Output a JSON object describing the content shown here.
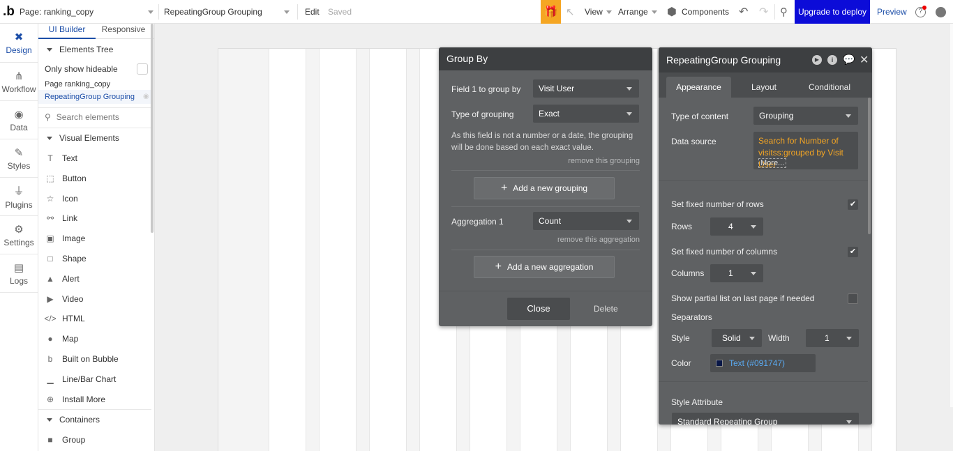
{
  "topbar": {
    "page_label": "Page: ranking_copy",
    "element_selector": "RepeatingGroup Grouping",
    "edit_label": "Edit",
    "saved_label": "Saved",
    "view_label": "View",
    "arrange_label": "Arrange",
    "components_label": "Components",
    "upgrade_label": "Upgrade to deploy",
    "preview_label": "Preview",
    "help_label": "?",
    "colors": {
      "upgrade_bg": "#0c0cd8",
      "gift_bg": "#f5a623",
      "preview": "#1c4ea8"
    }
  },
  "leftnav": {
    "items": [
      {
        "label": "Design",
        "icon": "design-icon"
      },
      {
        "label": "Workflow",
        "icon": "workflow-icon"
      },
      {
        "label": "Data",
        "icon": "data-icon"
      },
      {
        "label": "Styles",
        "icon": "styles-icon"
      },
      {
        "label": "Plugins",
        "icon": "plugins-icon"
      },
      {
        "label": "Settings",
        "icon": "settings-icon"
      },
      {
        "label": "Logs",
        "icon": "logs-icon"
      }
    ]
  },
  "sidepanel": {
    "tabs": [
      "UI Builder",
      "Responsive"
    ],
    "elements_tree_label": "Elements Tree",
    "only_hideable_label": "Only show hideable",
    "tree_items": [
      "Page ranking_copy",
      "RepeatingGroup Grouping"
    ],
    "search_placeholder": "Search elements",
    "visual_elements_label": "Visual Elements",
    "visual_elements": [
      {
        "label": "Text",
        "icon": "T"
      },
      {
        "label": "Button",
        "icon": "⬚"
      },
      {
        "label": "Icon",
        "icon": "☆"
      },
      {
        "label": "Link",
        "icon": "⚯"
      },
      {
        "label": "Image",
        "icon": "▣"
      },
      {
        "label": "Shape",
        "icon": "□"
      },
      {
        "label": "Alert",
        "icon": "▲"
      },
      {
        "label": "Video",
        "icon": "▶"
      },
      {
        "label": "HTML",
        "icon": "</>"
      },
      {
        "label": "Map",
        "icon": "●"
      },
      {
        "label": "Built on Bubble",
        "icon": "b"
      },
      {
        "label": "Line/Bar Chart",
        "icon": "▁"
      },
      {
        "label": "Install More",
        "icon": "⊕"
      }
    ],
    "containers_label": "Containers",
    "containers": [
      {
        "label": "Group",
        "icon": "■"
      }
    ]
  },
  "groupby": {
    "title": "Group By",
    "field1_label": "Field 1 to group by",
    "field1_value": "Visit User",
    "type_label": "Type of grouping",
    "type_value": "Exact",
    "hint": "As this field is not a number or a date, the grouping will be done based on each exact value.",
    "remove_grouping": "remove this grouping",
    "add_grouping": "Add a new grouping",
    "aggregation_label": "Aggregation 1",
    "aggregation_value": "Count",
    "remove_aggregation": "remove this aggregation",
    "add_aggregation": "Add a new aggregation",
    "close_label": "Close",
    "delete_label": "Delete"
  },
  "rgpanel": {
    "title": "RepeatingGroup Grouping",
    "tabs": [
      "Appearance",
      "Layout",
      "Conditional"
    ],
    "type_of_content_label": "Type of content",
    "type_of_content_value": "Grouping",
    "data_source_label": "Data source",
    "data_source_value": "Search for Number of visitss:grouped by Visit User",
    "more_label": "More...",
    "fixed_rows_label": "Set fixed number of rows",
    "rows_label": "Rows",
    "rows_value": "4",
    "fixed_columns_label": "Set fixed number of columns",
    "columns_label": "Columns",
    "columns_value": "1",
    "partial_list_label": "Show partial list on last page if needed",
    "separators_label": "Separators",
    "style_label": "Style",
    "style_value": "Solid",
    "width_label": "Width",
    "width_value": "1",
    "color_label": "Color",
    "color_value": "Text (#091747)",
    "style_attr_label": "Style Attribute",
    "style_attr_value": "Standard Repeating Group",
    "colors": {
      "data_source": "#f5a623",
      "color_link": "#5aa9f0"
    }
  }
}
